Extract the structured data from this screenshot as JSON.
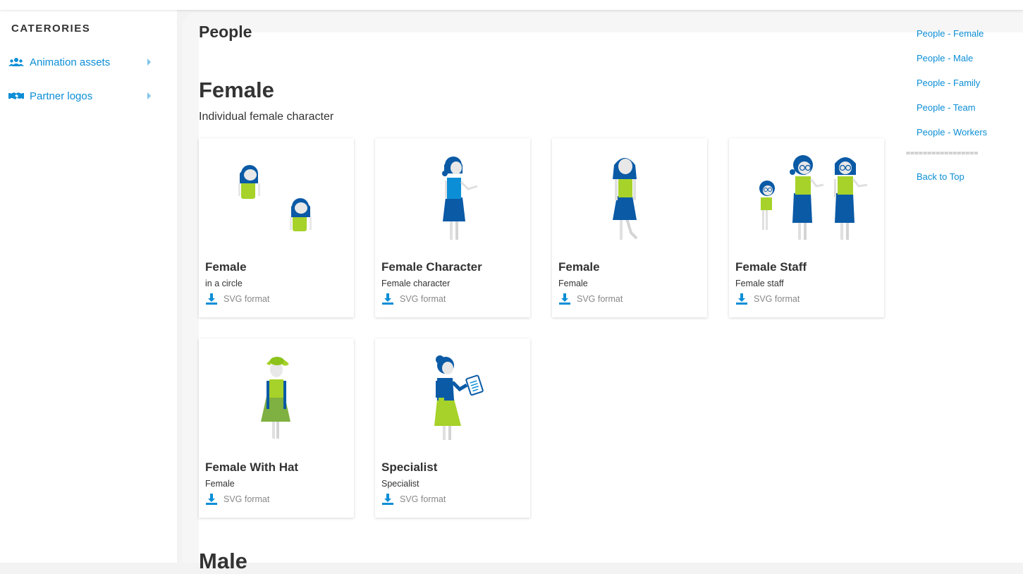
{
  "sidebar": {
    "title": "CATERORIES",
    "items": [
      {
        "label": "Animation assets",
        "icon": "users-icon"
      },
      {
        "label": "Partner logos",
        "icon": "handshake-icon"
      }
    ]
  },
  "page": {
    "title": "People",
    "section_title": "Female",
    "section_subtitle": "Individual female character",
    "next_section_title": "Male"
  },
  "cards": [
    {
      "title": "Female",
      "desc": "in a circle",
      "format": "SVG format"
    },
    {
      "title": "Female Character",
      "desc": "Female character",
      "format": "SVG format"
    },
    {
      "title": "Female",
      "desc": "Female",
      "format": "SVG format"
    },
    {
      "title": "Female Staff",
      "desc": "Female staff",
      "format": "SVG format"
    },
    {
      "title": "Female With Hat",
      "desc": "Female",
      "format": "SVG format"
    },
    {
      "title": "Specialist",
      "desc": "Specialist",
      "format": "SVG format"
    }
  ],
  "toc": {
    "links": [
      "People - Female",
      "People - Male",
      "People - Family",
      "People - Team",
      "People - Workers"
    ],
    "separator": "=================",
    "back_to_top": "Back to Top"
  },
  "colors": {
    "accent": "#0b8ed6",
    "navy": "#0a5aa6",
    "lime": "#a6d22a"
  }
}
